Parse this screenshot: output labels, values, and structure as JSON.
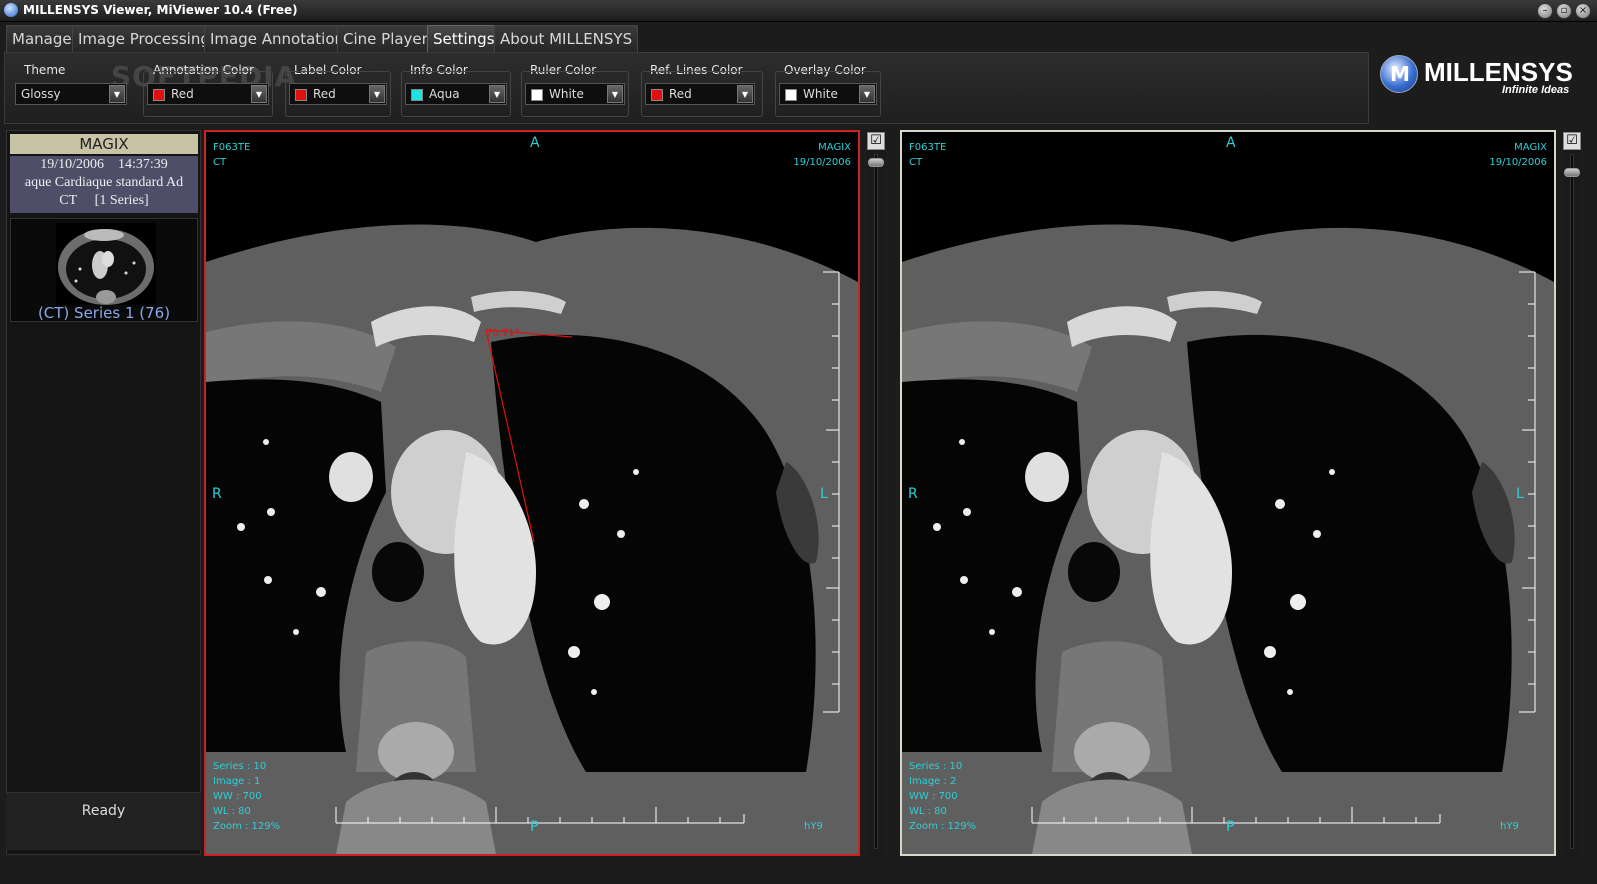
{
  "window": {
    "title": "MILLENSYS Viewer, MiViewer 10.4 (Free)"
  },
  "tabs": [
    {
      "label": "Manage"
    },
    {
      "label": "Image Processing"
    },
    {
      "label": "Image Annotation"
    },
    {
      "label": "Cine Player"
    },
    {
      "label": "Settings",
      "active": true
    },
    {
      "label": "About MILLENSYS"
    }
  ],
  "watermark": "SOFTPEDIA",
  "settings": {
    "theme": {
      "label": "Theme",
      "value": "Glossy"
    },
    "annotation_color": {
      "label": "Annotation Color",
      "value": "Red",
      "swatch": "#e01010"
    },
    "label_color": {
      "label": "Label Color",
      "value": "Red",
      "swatch": "#e01010"
    },
    "info_color": {
      "label": "Info Color",
      "value": "Aqua",
      "swatch": "#1ee3e3"
    },
    "ruler_color": {
      "label": "Ruler Color",
      "value": "White",
      "swatch": "#ffffff"
    },
    "ref_lines_color": {
      "label": "Ref. Lines Color",
      "value": "Red",
      "swatch": "#e01010"
    },
    "overlay_color": {
      "label": "Overlay Color",
      "value": "White",
      "swatch": "#ffffff"
    }
  },
  "logo": {
    "letter": "M",
    "name": "MILLENSYS",
    "tagline": "Infinite Ideas"
  },
  "study": {
    "header": "MAGIX",
    "date": "19/10/2006",
    "time": "14:37:39",
    "description": "aque Cardiaque standard  Ad",
    "modality": "CT",
    "series_count": "[1 Series]",
    "series": [
      {
        "label": "(CT) Series 1 (76)"
      }
    ]
  },
  "status": "Ready",
  "viewports": [
    {
      "patient_id": "F063TE",
      "modality": "CT",
      "institution": "MAGIX",
      "date": "19/10/2006",
      "orient_top": "A",
      "orient_bottom": "P",
      "orient_left": "R",
      "orient_right": "L",
      "series": "Series : 10",
      "image": "Image : 1",
      "ww": "WW   : 700",
      "wl": "WL   : 80",
      "zoom": "Zoom : 129%",
      "corner": "hY9",
      "angle_label": "70.71°",
      "selected": true
    },
    {
      "patient_id": "F063TE",
      "modality": "CT",
      "institution": "MAGIX",
      "date": "19/10/2006",
      "orient_top": "A",
      "orient_bottom": "P",
      "orient_left": "R",
      "orient_right": "L",
      "series": "Series : 10",
      "image": "Image : 2",
      "ww": "WW   : 700",
      "wl": "WL   : 80",
      "zoom": "Zoom : 129%",
      "corner": "hY9",
      "selected": false
    }
  ],
  "colors": {
    "overlay_text": "#2ecfd6",
    "active_border": "#cc2222",
    "annotation": "#e01010"
  }
}
